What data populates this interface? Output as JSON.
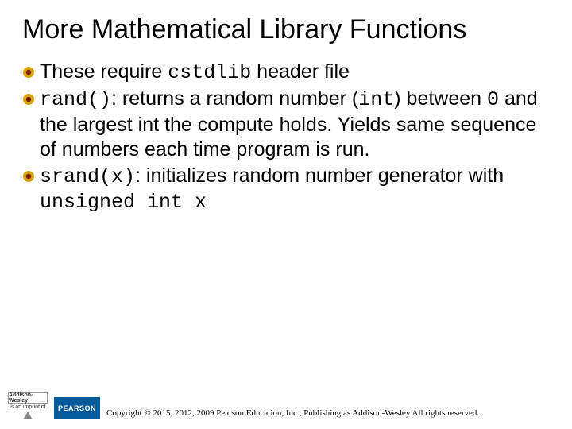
{
  "title": "More Mathematical Library Functions",
  "bullets": {
    "b1": {
      "t1": "These require ",
      "c1": "cstdlib",
      "t2": " header file"
    },
    "b2": {
      "c1": "rand()",
      "t1": ": returns a random number (",
      "c2": "int",
      "t2": ") between ",
      "c3": "0",
      "t3": " and the largest int the compute holds. Yields same sequence of numbers each time program is run."
    },
    "b3": {
      "c1": "srand(x)",
      "t1": ": initializes random number generator with ",
      "c2": "unsigned int x"
    }
  },
  "footer": {
    "aw_label": "Addison-Wesley",
    "aw_sub": "is an imprint of",
    "pearson": "PEARSON",
    "copyright": "Copyright © 2015, 2012, 2009 Pearson Education, Inc., Publishing as Addison-Wesley All rights reserved."
  }
}
